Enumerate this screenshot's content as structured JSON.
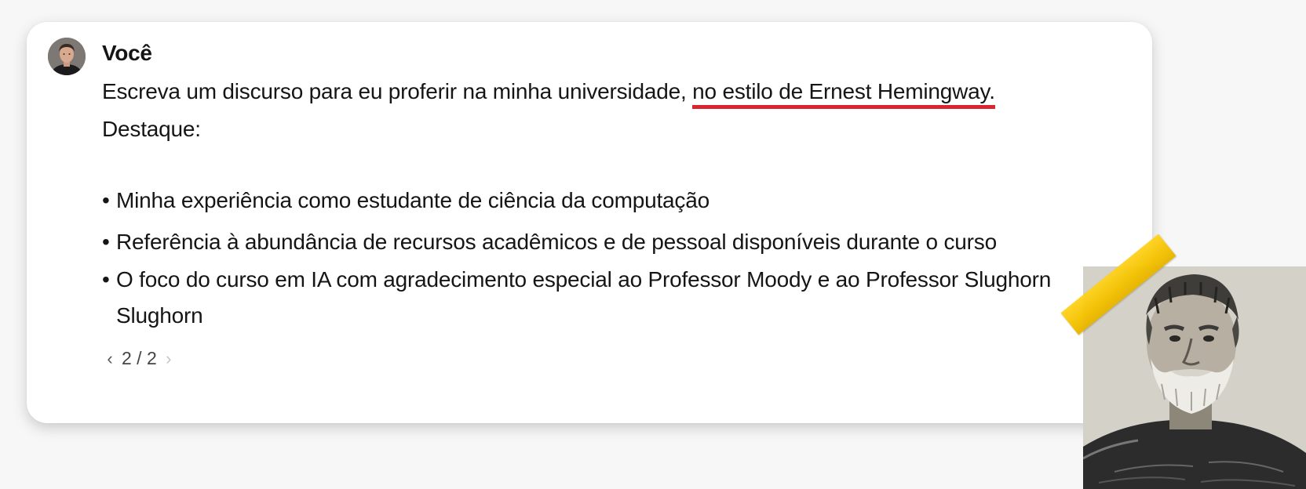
{
  "message": {
    "sender": "Você",
    "line1_prefix": "Escreva um discurso para eu proferir na minha universidade, ",
    "line1_highlight": "no estilo de Ernest Hemingway.",
    "line2": "Destaque:",
    "bullets": [
      "Minha experiência como estudante de ciência da computação",
      "Referência à abundância de recursos acadêmicos e de pessoal disponíveis durante o curso",
      "O foco do curso em IA com agradecimento especial ao Professor Moody e ao Professor Slughorn"
    ],
    "bullet3_wrap": "Slughorn",
    "bullet_symbol": "•"
  },
  "pager": {
    "prev_icon": "chevron-left-icon",
    "next_icon": "chevron-right-icon",
    "text": "2 / 2"
  },
  "colors": {
    "highlight_underline": "#d9252f",
    "tape": "#f4c200",
    "card_background": "#ffffff"
  }
}
